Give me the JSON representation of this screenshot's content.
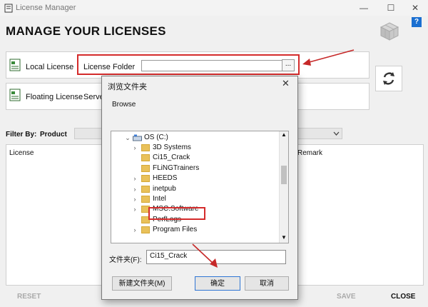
{
  "window": {
    "title": "License Manager",
    "minimize": "—",
    "maximize": "☐",
    "close": "✕"
  },
  "header": {
    "heading": "MANAGE YOUR LICENSES",
    "help": "?"
  },
  "local_license": {
    "label": "Local License",
    "folder_label": "License Folder",
    "folder_value": "",
    "browse": "..."
  },
  "floating_license": {
    "label": "Floating License",
    "server_label": "Server"
  },
  "filter": {
    "label": "Filter By:",
    "value": "Product"
  },
  "grid": {
    "col_license": "License",
    "col_remark": "Remark"
  },
  "footer": {
    "reset": "RESET",
    "save": "SAVE",
    "close": "CLOSE"
  },
  "dialog": {
    "title": "浏览文件夹",
    "close": "✕",
    "prompt": "Browse",
    "tree": {
      "root": "OS (C:)",
      "items": [
        "3D Systems",
        "Ci15_Crack",
        "FLiNGTrainers",
        "HEEDS",
        "inetpub",
        "Intel",
        "MSC.Software",
        "PerfLogs",
        "Program Files"
      ]
    },
    "folder_label": "文件夹(F):",
    "folder_value": "Ci15_Crack",
    "new_folder": "新建文件夹(M)",
    "ok": "确定",
    "cancel": "取消"
  },
  "colors": {
    "highlight_box": "#d42b2b",
    "arrow": "#c62828",
    "folder": "#e9c15a"
  }
}
